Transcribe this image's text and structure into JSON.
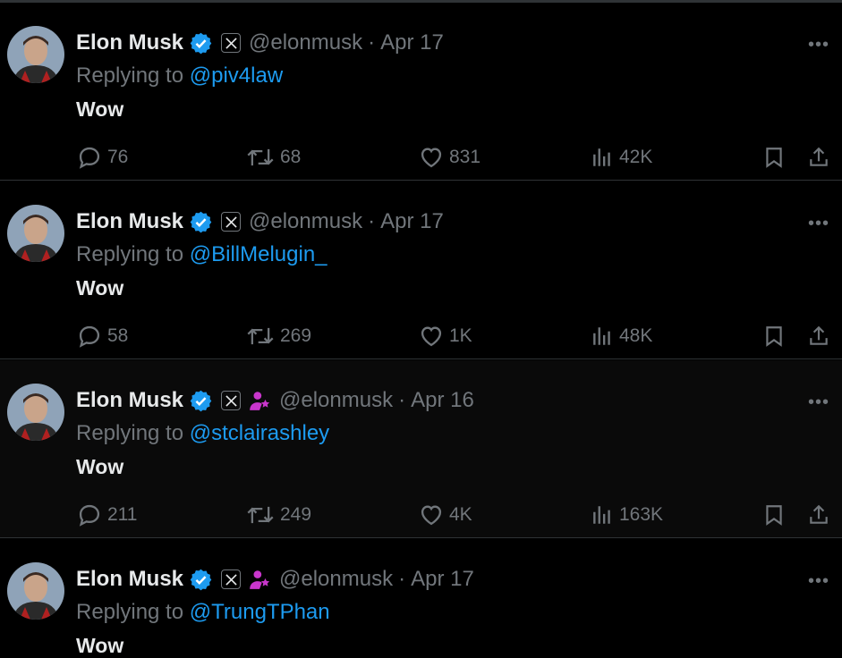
{
  "tweets": [
    {
      "name": "Elon Musk",
      "handle": "@elonmusk",
      "date": "Apr 17",
      "replying_prefix": "Replying to",
      "replying_to": "@piv4law",
      "text": "Wow",
      "replies": "76",
      "retweets": "68",
      "likes": "831",
      "views": "42K",
      "affiliate_badge": false
    },
    {
      "name": "Elon Musk",
      "handle": "@elonmusk",
      "date": "Apr 17",
      "replying_prefix": "Replying to",
      "replying_to": "@BillMelugin_",
      "text": "Wow",
      "replies": "58",
      "retweets": "269",
      "likes": "1K",
      "views": "48K",
      "affiliate_badge": false
    },
    {
      "name": "Elon Musk",
      "handle": "@elonmusk",
      "date": "Apr 16",
      "replying_prefix": "Replying to",
      "replying_to": "@stclairashley",
      "text": "Wow",
      "replies": "211",
      "retweets": "249",
      "likes": "4K",
      "views": "163K",
      "affiliate_badge": true
    },
    {
      "name": "Elon Musk",
      "handle": "@elonmusk",
      "date": "Apr 17",
      "replying_prefix": "Replying to",
      "replying_to": "@TrungTPhan",
      "text": "Wow",
      "replies": "",
      "retweets": "",
      "likes": "",
      "views": "",
      "affiliate_badge": true
    }
  ],
  "colors": {
    "background": "#000000",
    "text": "#e7e9ea",
    "muted": "#71767b",
    "accent": "#1d9bf0",
    "affiliate": "#c936cc"
  },
  "icons": [
    "verified-badge-icon",
    "x-logo-icon",
    "affiliate-icon",
    "more-icon",
    "reply-icon",
    "retweet-icon",
    "like-icon",
    "views-icon",
    "bookmark-icon",
    "share-icon"
  ]
}
